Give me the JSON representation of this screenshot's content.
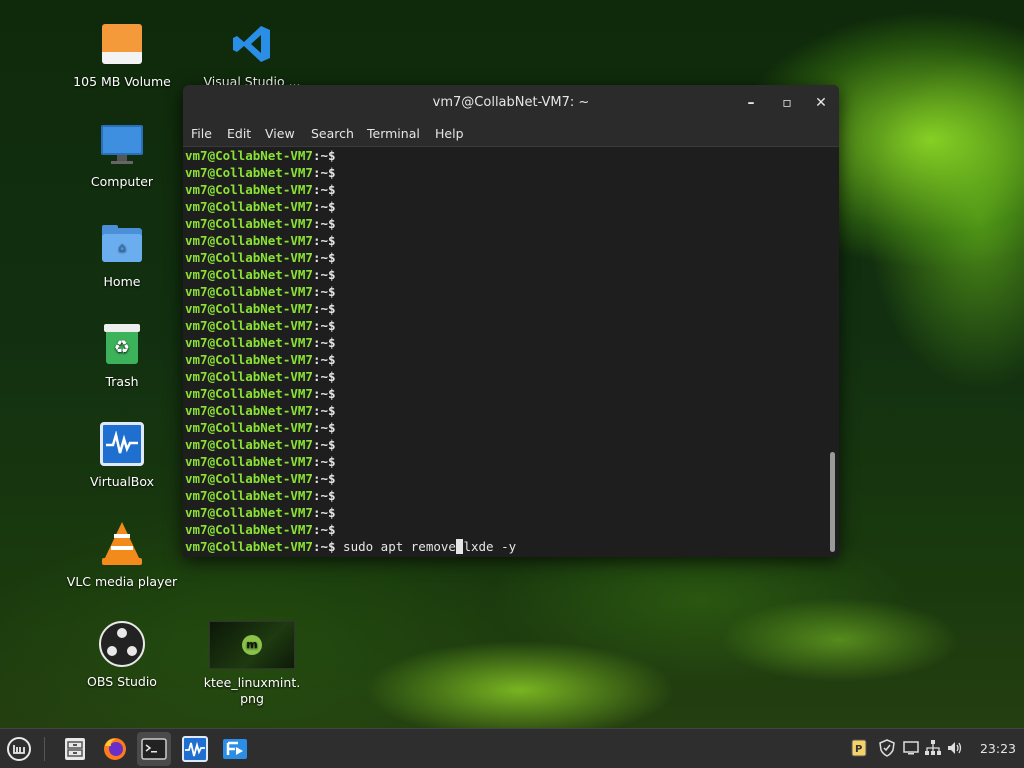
{
  "desktop": {
    "icons": [
      {
        "label": "105 MB Volume",
        "icon": "drive-icon"
      },
      {
        "label": "Computer",
        "icon": "computer-icon"
      },
      {
        "label": "Home",
        "icon": "home-folder-icon"
      },
      {
        "label": "Trash",
        "icon": "trash-icon"
      },
      {
        "label": "VirtualBox",
        "icon": "virtualbox-icon"
      },
      {
        "label": "VLC media player",
        "icon": "vlc-icon"
      },
      {
        "label": "OBS Studio",
        "icon": "obs-icon"
      },
      {
        "label": "Visual Studio ...",
        "icon": "vscode-icon"
      },
      {
        "label": "ktee_linuxmint.\npng",
        "icon": "image-thumbnail-icon"
      }
    ]
  },
  "terminal": {
    "title": "vm7@CollabNet-VM7: ~",
    "menu": [
      "File",
      "Edit",
      "View",
      "Search",
      "Terminal",
      "Help"
    ],
    "prompt_user": "vm7@CollabNet-VM7",
    "prompt_path": ":~$",
    "empty_prompt_count": 23,
    "command_before_cursor": " sudo apt remove",
    "cursor_char": " ",
    "command_after_cursor": "lxde -y"
  },
  "panel": {
    "launchers": [
      "mint-menu-icon",
      "file-manager-icon",
      "firefox-icon",
      "terminal-icon",
      "virtualbox-icon",
      "remote-desktop-icon"
    ],
    "tray": [
      "parcellite-icon",
      "shield-icon",
      "display-icon",
      "network-icon",
      "volume-icon"
    ],
    "clock": "23:23"
  },
  "colors": {
    "prompt_green": "#8ae234",
    "terminal_bg": "#1e1e1e",
    "panel_bg": "#2e2e2e"
  }
}
